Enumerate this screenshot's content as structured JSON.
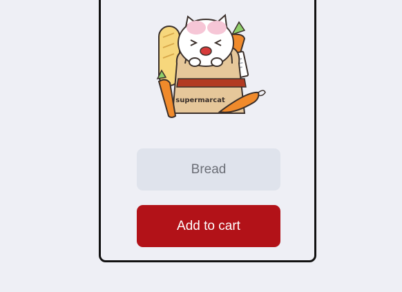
{
  "illustration": {
    "bag_text": "supermarcat"
  },
  "form": {
    "item_placeholder": "Bread",
    "add_button_label": "Add to cart"
  },
  "colors": {
    "background": "#eeeff5",
    "field_background": "#dfe3ec",
    "button_background": "#b21218",
    "button_text": "#ffffff",
    "border": "#111111"
  }
}
